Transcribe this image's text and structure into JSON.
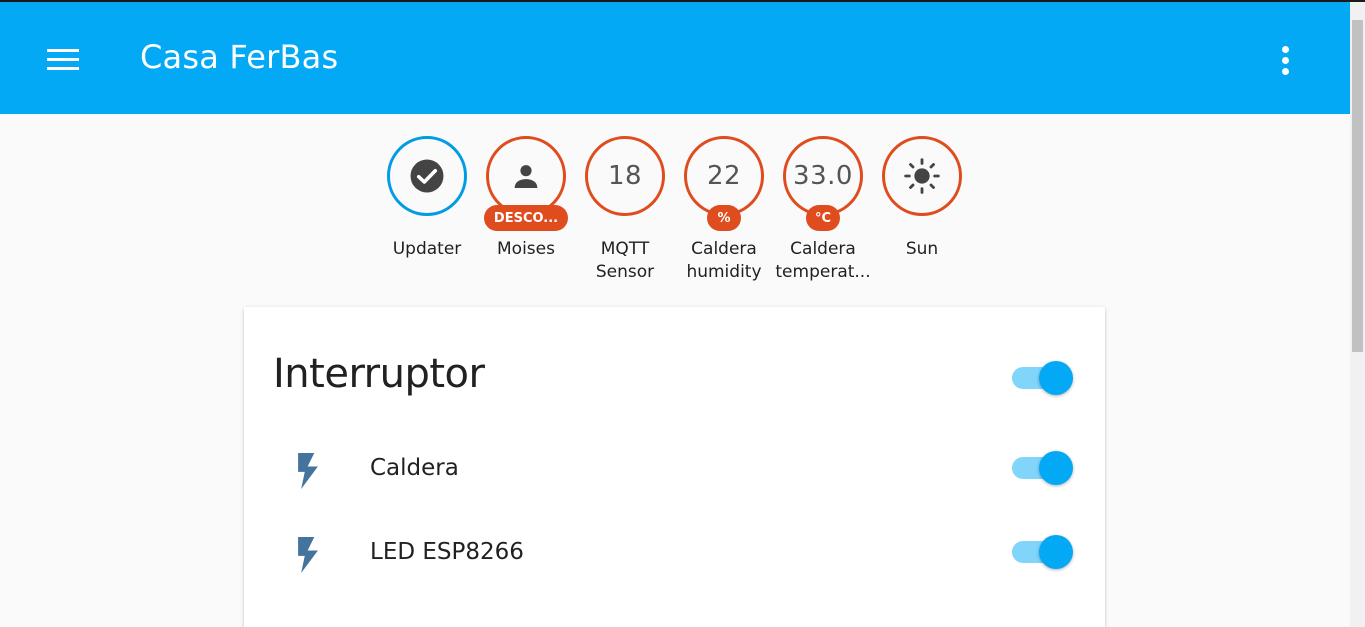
{
  "header": {
    "title": "Casa FerBas",
    "menu_icon": "menu-icon",
    "overflow_icon": "dots-vertical-icon",
    "color": "#03a9f4"
  },
  "badges": [
    {
      "label": "Updater",
      "icon": "check-circle-icon",
      "value": "",
      "unit": "",
      "border_color": "#039be5"
    },
    {
      "label": "Moises",
      "icon": "account-icon",
      "value": "",
      "unit": "DESCO...",
      "border_color": "#df4c1e"
    },
    {
      "label": "MQTT Sensor",
      "icon": "",
      "value": "18",
      "unit": "",
      "border_color": "#df4c1e"
    },
    {
      "label": "Caldera humidity",
      "icon": "",
      "value": "22",
      "unit": "%",
      "border_color": "#df4c1e"
    },
    {
      "label": "Caldera temperat...",
      "icon": "",
      "value": "33.0",
      "unit": "°C",
      "border_color": "#df4c1e"
    },
    {
      "label": "Sun",
      "icon": "sun-icon",
      "value": "",
      "unit": "",
      "border_color": "#df4c1e"
    }
  ],
  "card": {
    "title": "Interruptor",
    "master_toggle_on": true,
    "entities": [
      {
        "name": "Caldera",
        "icon": "flash-icon",
        "on": true
      },
      {
        "name": "LED ESP8266",
        "icon": "flash-icon",
        "on": true
      }
    ]
  },
  "colors": {
    "accent": "#03a9f4",
    "badge_border": "#df4c1e",
    "icon": "#44739e"
  }
}
